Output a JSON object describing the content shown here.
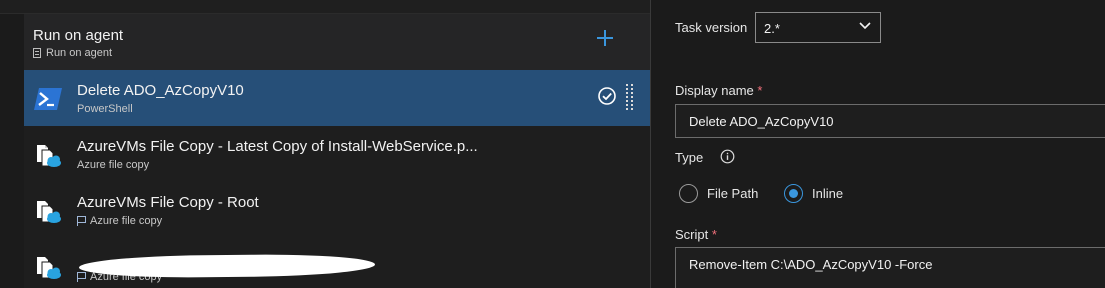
{
  "phase": {
    "title": "Run on agent",
    "subtitle": "Run on agent",
    "add_icon": "plus-icon"
  },
  "tasks": [
    {
      "name": "Delete ADO_AzCopyV10",
      "subtitle": "PowerShell",
      "icon": "powershell-icon",
      "selected": true
    },
    {
      "name": "AzureVMs File Copy - Latest Copy of Install-WebService.p...",
      "subtitle": "Azure file copy",
      "icon": "azure-file-copy-icon"
    },
    {
      "name": "AzureVMs File Copy - Root",
      "subtitle": "Azure file copy",
      "icon": "azure-file-copy-icon",
      "flag": true
    },
    {
      "name": "",
      "subtitle": "Azure file copy",
      "icon": "azure-file-copy-icon",
      "flag": true
    }
  ],
  "details": {
    "task_version_label": "Task version",
    "task_version_value": "2.*",
    "display_name_label": "Display name",
    "display_name_value": "Delete ADO_AzCopyV10",
    "type_label": "Type",
    "type_options": [
      {
        "label": "File Path",
        "checked": false
      },
      {
        "label": "Inline",
        "checked": true
      }
    ],
    "script_label": "Script",
    "script_value": "Remove-Item C:\\ADO_AzCopyV10 -Force",
    "required_marker": "*"
  },
  "colors": {
    "accent": "#3a96dd",
    "selected_row": "#264f78",
    "required": "#f1707b"
  }
}
